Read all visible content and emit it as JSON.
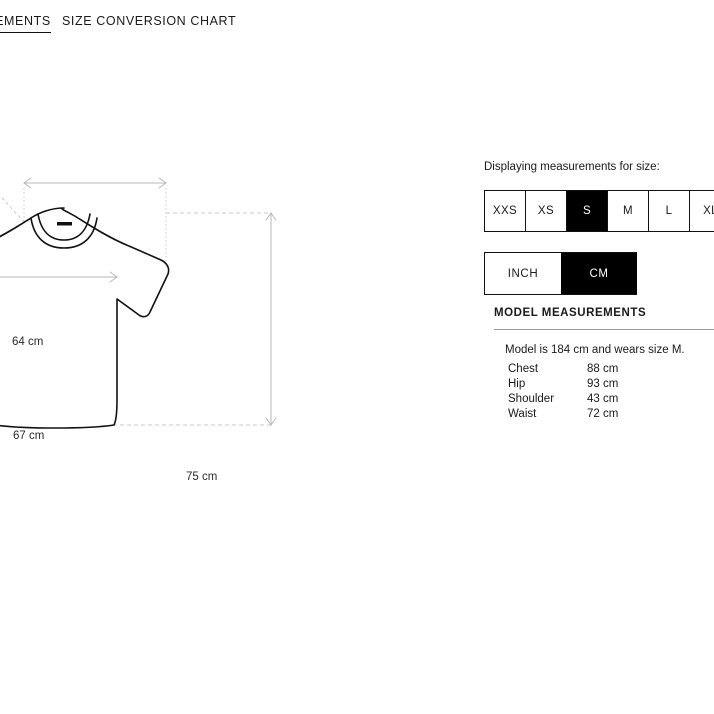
{
  "tabs": [
    {
      "label": "MEASUREMENTS",
      "active": true
    },
    {
      "label": "SIZE CONVERSION CHART",
      "active": false
    }
  ],
  "garment": {
    "type": "t-shirt-technical-drawing",
    "dimensions": {
      "shoulder_width": "64 cm",
      "chest_width": "67 cm",
      "length": "75 cm"
    }
  },
  "options": {
    "displaying_label": "Displaying measurements for size:",
    "sizes": [
      "XXS",
      "XS",
      "S",
      "M",
      "L",
      "XL"
    ],
    "selected_size": "S",
    "units": [
      "INCH",
      "CM"
    ],
    "selected_unit": "CM"
  },
  "model": {
    "heading": "MODEL MEASUREMENTS",
    "intro": "Model is 184 cm and wears size M.",
    "rows": [
      {
        "label": "Chest",
        "value": "88 cm"
      },
      {
        "label": "Hip",
        "value": "93 cm"
      },
      {
        "label": "Shoulder",
        "value": "43 cm"
      },
      {
        "label": "Waist",
        "value": "72 cm"
      }
    ]
  },
  "colors": {
    "selected_bg": "#000000",
    "selected_fg": "#ffffff",
    "border": "#111111",
    "text": "#1a1a1a",
    "dim_line": "#b8b8b8",
    "guide_line": "#c9c9c9",
    "garment_outline": "#111111"
  }
}
